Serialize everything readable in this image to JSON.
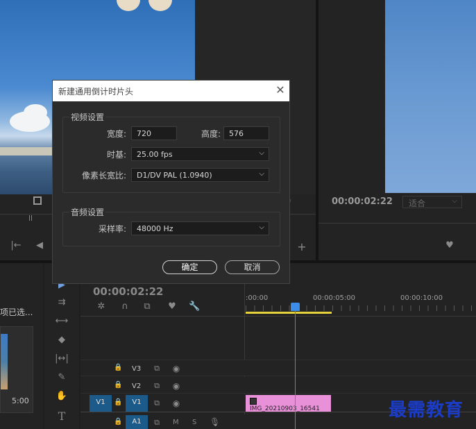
{
  "dialog": {
    "title": "新建通用倒计时片头",
    "close_glyph": "✕",
    "video_group": "视频设置",
    "width_label": "宽度:",
    "width_value": "720",
    "height_label": "高度:",
    "height_value": "576",
    "timebase_label": "时基:",
    "timebase_value": "25.00 fps",
    "pixel_aspect_label": "像素长宽比:",
    "pixel_aspect_value": "D1/DV PAL (1.0940)",
    "audio_group": "音频设置",
    "sample_rate_label": "采样率:",
    "sample_rate_value": "48000 Hz",
    "ok_label": "确定",
    "cancel_label": "取消"
  },
  "source_monitor": {
    "timecode_partial": "0"
  },
  "program_monitor": {
    "timecode": "00:00:02:22",
    "fit_value": "适合"
  },
  "timeline": {
    "timecode": "00:00:02:22",
    "ruler": [
      ":00:00",
      "00:00:05:00",
      "00:00:10:00"
    ],
    "tracks": [
      {
        "name": "V3",
        "source": ""
      },
      {
        "name": "V2",
        "source": ""
      },
      {
        "name": "V1",
        "source": "V1"
      },
      {
        "name": "A1",
        "source": ""
      }
    ],
    "clip_name": "IMG_20210903_16541",
    "audio_m": "M",
    "audio_s": "S"
  },
  "project_panel": {
    "selection_text": "项已选...",
    "duration": "5:00"
  },
  "watermark": "最需教育"
}
